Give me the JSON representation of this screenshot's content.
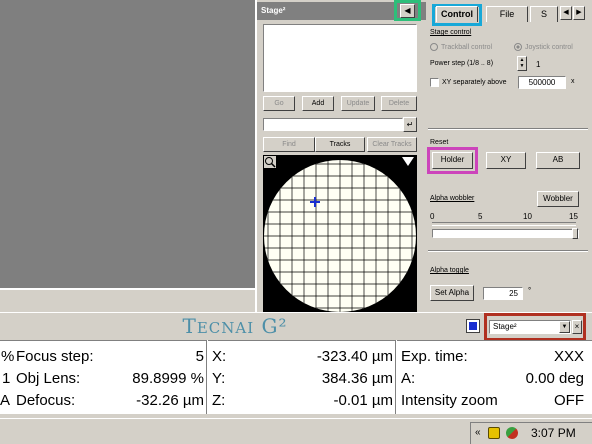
{
  "stage_window": {
    "title": "Stage²",
    "buttons": [
      "Go",
      "Add",
      "Update",
      "Delete",
      "Find",
      "Tracks",
      "Clear Tracks"
    ],
    "enter_glyph": "↵"
  },
  "tabs": [
    {
      "label": "Control"
    },
    {
      "label": "File"
    },
    {
      "label": "S"
    }
  ],
  "stage_control": {
    "heading": "Stage control",
    "trackball": "Trackball control",
    "joystick": "Joystick control",
    "power_step_label": "Power step (1/8 .. 8)",
    "power_step_value": "1",
    "xy_label": "XY separately above",
    "xy_value": "500000",
    "xy_unit": "x"
  },
  "reset": {
    "heading": "Reset",
    "holder": "Holder",
    "xy": "XY",
    "ab": "AB"
  },
  "alpha_wobbler": {
    "heading": "Alpha wobbler",
    "button": "Wobbler",
    "ticks": [
      "0",
      "5",
      "10",
      "15"
    ],
    "level": 1.0
  },
  "alpha_toggle": {
    "heading": "Alpha toggle",
    "button": "Set Alpha",
    "value": "25",
    "unit": "°"
  },
  "brand": "Tecnai G²",
  "selector": {
    "value": "Stage²"
  },
  "readouts": {
    "col1": [
      {
        "prefix": "%",
        "label": "Focus step:",
        "value": "5"
      },
      {
        "prefix": "1",
        "label": "Obj Lens:",
        "value": "89.8999 %"
      },
      {
        "prefix": "A",
        "label": "Defocus:",
        "value": "-32.26 µm"
      }
    ],
    "col2": [
      {
        "label": "X:",
        "value": "-323.40 µm"
      },
      {
        "label": "Y:",
        "value": "384.36 µm"
      },
      {
        "label": "Z:",
        "value": "-0.01 µm"
      }
    ],
    "col3": [
      {
        "label": "Exp. time:",
        "value": "XXX"
      },
      {
        "label": "A:",
        "value": "0.00 deg"
      },
      {
        "label": "Intensity zoom",
        "value": "OFF"
      }
    ]
  },
  "taskbar": {
    "clock": "3:07 PM"
  },
  "colors": {
    "highlight_green": "#2dbf7a",
    "highlight_cyan": "#17a8d8",
    "highlight_magenta": "#cc44bb",
    "highlight_red": "#b03020",
    "brand": "#4d8fa8"
  }
}
